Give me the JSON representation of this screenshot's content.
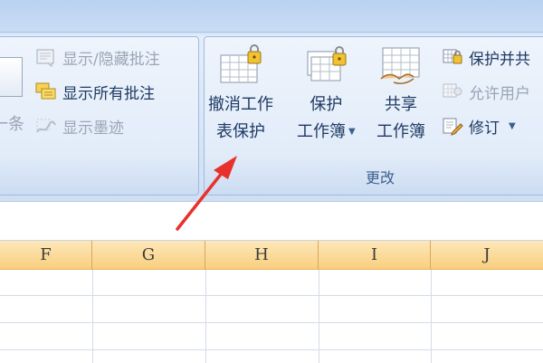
{
  "ribbon": {
    "comments_group": {
      "show_hide_comment": "显示/隐藏批注",
      "show_all_comments": "显示所有批注",
      "show_ink": "显示墨迹",
      "partial_label": "一条"
    },
    "changes_group": {
      "label": "更改",
      "unprotect_sheet": [
        "撤消工作",
        "表保护"
      ],
      "protect_workbook": [
        "保护",
        "工作簿"
      ],
      "share_workbook": [
        "共享",
        "工作簿"
      ],
      "protect_and_share": "保护并共",
      "allow_users": "允许用户",
      "track_changes": "修订"
    }
  },
  "sheet": {
    "columns": [
      "F",
      "G",
      "H",
      "I",
      "J"
    ]
  },
  "colors": {
    "accent_arrow": "#e8312c",
    "column_header": "#f9cf7f"
  }
}
